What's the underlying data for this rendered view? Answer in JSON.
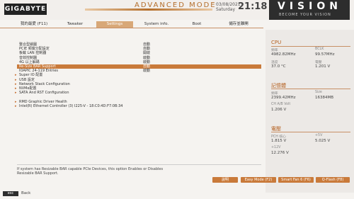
{
  "header": {
    "brand": "GIGABYTE",
    "mode": "ADVANCED MODE",
    "date": "03/08/2021",
    "day": "Saturday",
    "time": "21:18",
    "logo_big": "VISION",
    "logo_small": "BECOME YOUR VISION"
  },
  "tabs": [
    {
      "label": "我的最愛 (F11)"
    },
    {
      "label": "Tweaker"
    },
    {
      "label": "Settings"
    },
    {
      "label": "System info."
    },
    {
      "label": "Boot"
    },
    {
      "label": "儲存並離開"
    }
  ],
  "menu": [
    {
      "label": "整合型繪圖",
      "value": "自動"
    },
    {
      "label": "PCIE 頻寬分配設定",
      "value": "自動"
    },
    {
      "label": "板載 LAN 控制器",
      "value": "開啟"
    },
    {
      "label": "音效控制器",
      "value": "啟動"
    },
    {
      "label": "4G 以上解碼",
      "value": "啟動"
    },
    {
      "label": "Re-Size BAR Support",
      "value": "自動"
    },
    {
      "label": "IOAPIC 24-119 Entries",
      "value": "啟動"
    },
    {
      "label": "Super IO 配置",
      "value": ""
    },
    {
      "label": "USB 設定",
      "value": ""
    },
    {
      "label": "Network Stack Configuration",
      "value": ""
    },
    {
      "label": "NVMe配置",
      "value": ""
    },
    {
      "label": "SATA And RST Configuration",
      "value": ""
    },
    {
      "label": "",
      "value": ""
    },
    {
      "label": "RMD Graphic Driver Health",
      "value": ""
    },
    {
      "label": "Intel(R) Ethernet Controller (3) I225-V - 18:C0:4D:F7:0B:34",
      "value": ""
    }
  ],
  "help": {
    "line1": "If system has Resizable BAR capable PCIe Devices, this option Enables or Disables",
    "line2": "Resizable BAR Support."
  },
  "side": {
    "cpu_title": "CPU",
    "freq_label": "頻率",
    "freq_value": "4982.82MHz",
    "bclk_label": "BCLK",
    "bclk_value": "99.57MHz",
    "temp_label": "溫度",
    "temp_value": "37.0 °C",
    "volt_label": "電壓",
    "volt_value": "1.201 V",
    "mem_title": "記憶體",
    "mfreq_label": "頻率",
    "mfreq_value": "2399.42MHz",
    "size_label": "Size",
    "size_value": "16384MB",
    "chv_label": "CH A/B Volt",
    "chv_value": "1.206 V",
    "pow_title": "電壓",
    "pch_label": "PCH 核心",
    "pch_value": "1.815 V",
    "v5_label": "+5V",
    "v5_value": "5.025 V",
    "v12_label": "+12V",
    "v12_value": "12.276 V"
  },
  "buttons": {
    "help": "說明",
    "easy": "Easy Mode (F2)",
    "smartfan": "Smart Fan 6 (F6)",
    "qflash": "Q-Flash (F8)"
  },
  "footer": {
    "esc": "esc",
    "back": "Back"
  },
  "colors": {
    "accent": "#c97a3a",
    "title": "#b45f1e"
  }
}
